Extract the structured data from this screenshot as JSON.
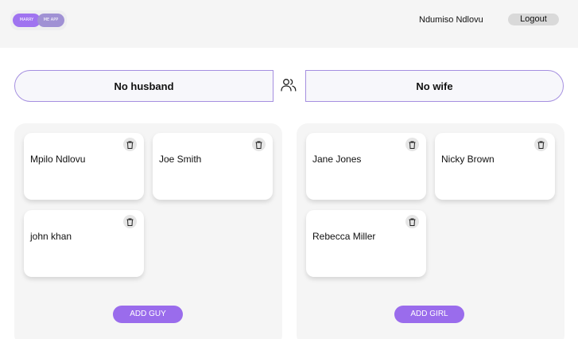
{
  "header": {
    "logo_left": "MARRY",
    "logo_right": "ME APP",
    "user_name": "Ndumiso Ndlovu",
    "logout_label": "Logout"
  },
  "pairing": {
    "left_label": "No husband",
    "right_label": "No wife",
    "icon": "users-icon"
  },
  "guys": {
    "items": [
      {
        "name": "Mpilo Ndlovu"
      },
      {
        "name": "Joe Smith"
      },
      {
        "name": "john khan"
      }
    ],
    "add_label": "ADD GUY"
  },
  "girls": {
    "items": [
      {
        "name": "Jane Jones"
      },
      {
        "name": "Nicky Brown"
      },
      {
        "name": "Rebecca Miller"
      }
    ],
    "add_label": "ADD GIRL"
  },
  "colors": {
    "accent": "#9a6cec",
    "pair_border": "#a58fe0",
    "panel_bg": "#f5f5f5"
  }
}
